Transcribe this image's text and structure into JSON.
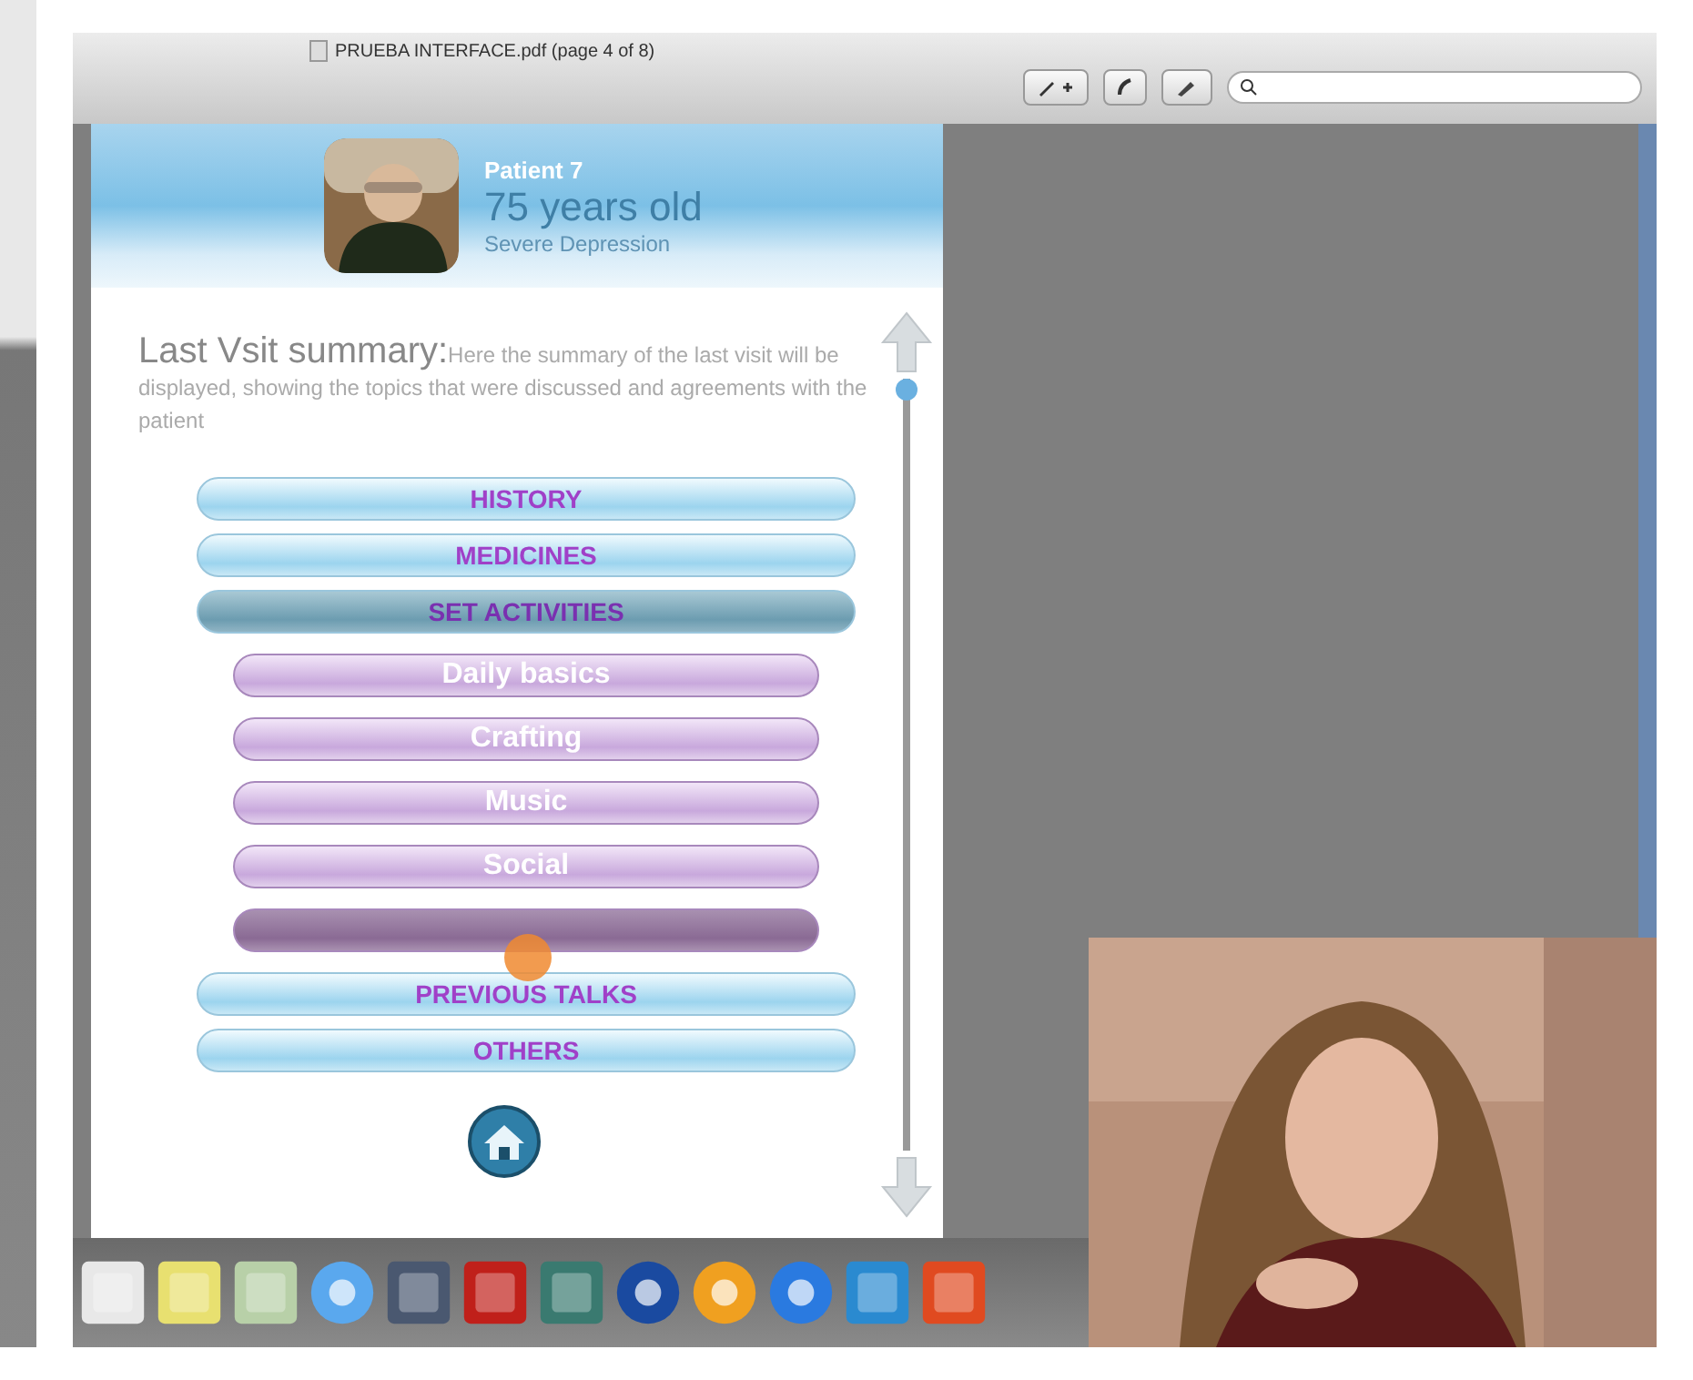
{
  "window": {
    "title": "PRUEBA INTERFACE.pdf (page 4 of 8)"
  },
  "patient": {
    "name": "Patient 7",
    "age": "75 years old",
    "condition": "Severe Depression"
  },
  "summary": {
    "title": "Last Vsit summary:",
    "text": "Here the summary of the last visit will be displayed, showing the topics that were discussed and agreements with the patient"
  },
  "menu": [
    {
      "label": "HISTORY",
      "selected": false
    },
    {
      "label": "MEDICINES",
      "selected": false
    },
    {
      "label": "SET ACTIVITIES",
      "selected": true,
      "children": [
        {
          "label": "Daily basics",
          "selected": false
        },
        {
          "label": "Crafting",
          "selected": false
        },
        {
          "label": "Music",
          "selected": false
        },
        {
          "label": "Social",
          "selected": false
        },
        {
          "selected": true
        }
      ]
    },
    {
      "label": "PREVIOUS TALKS",
      "selected": false
    },
    {
      "label": "OTHERS",
      "selected": false
    }
  ]
}
